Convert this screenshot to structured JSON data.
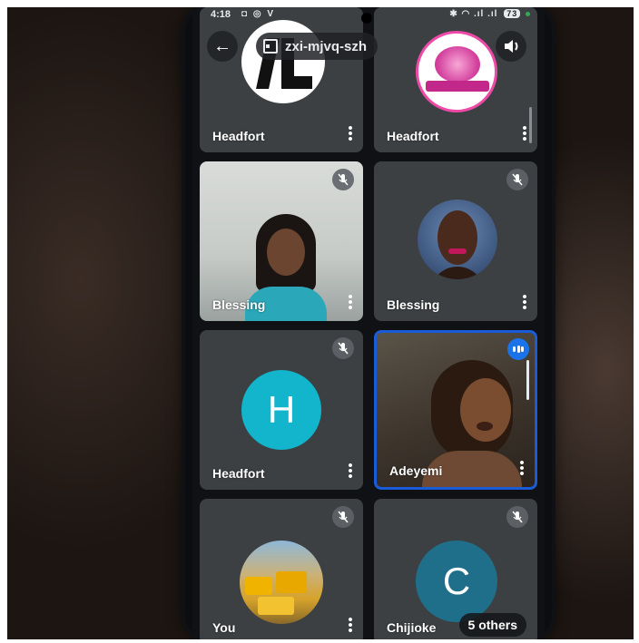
{
  "status_bar": {
    "time": "4:18",
    "left_icons": "◘ ◎ V",
    "right_icons": "✱ ◠ .ıl .ıl",
    "battery": "73"
  },
  "top_bar": {
    "back_icon": "arrow-left-icon",
    "meeting_code": "zxi-mjvq-szh",
    "speaker_icon": "speaker-icon"
  },
  "tiles": [
    {
      "name": "Headfort",
      "type": "avatar-logo",
      "muted": false
    },
    {
      "name": "Headfort",
      "type": "avatar-logo",
      "muted": false
    },
    {
      "name": "Blessing",
      "type": "video",
      "muted": true
    },
    {
      "name": "Blessing",
      "type": "avatar-photo",
      "muted": true
    },
    {
      "name": "Headfort",
      "type": "avatar-letter",
      "letter": "H",
      "color": "#12b5cb",
      "muted": true
    },
    {
      "name": "Adeyemi",
      "type": "video",
      "speaking": true
    },
    {
      "name": "You",
      "type": "avatar-photo",
      "muted": true
    },
    {
      "name": "Chijioke",
      "type": "avatar-letter",
      "letter": "C",
      "color": "#1f6f8b",
      "muted": true
    }
  ],
  "others_chip": "5 others",
  "colors": {
    "tile_bg": "#3c4043",
    "active_border": "#1a5cd8",
    "screen_bg": "#0f1114"
  }
}
